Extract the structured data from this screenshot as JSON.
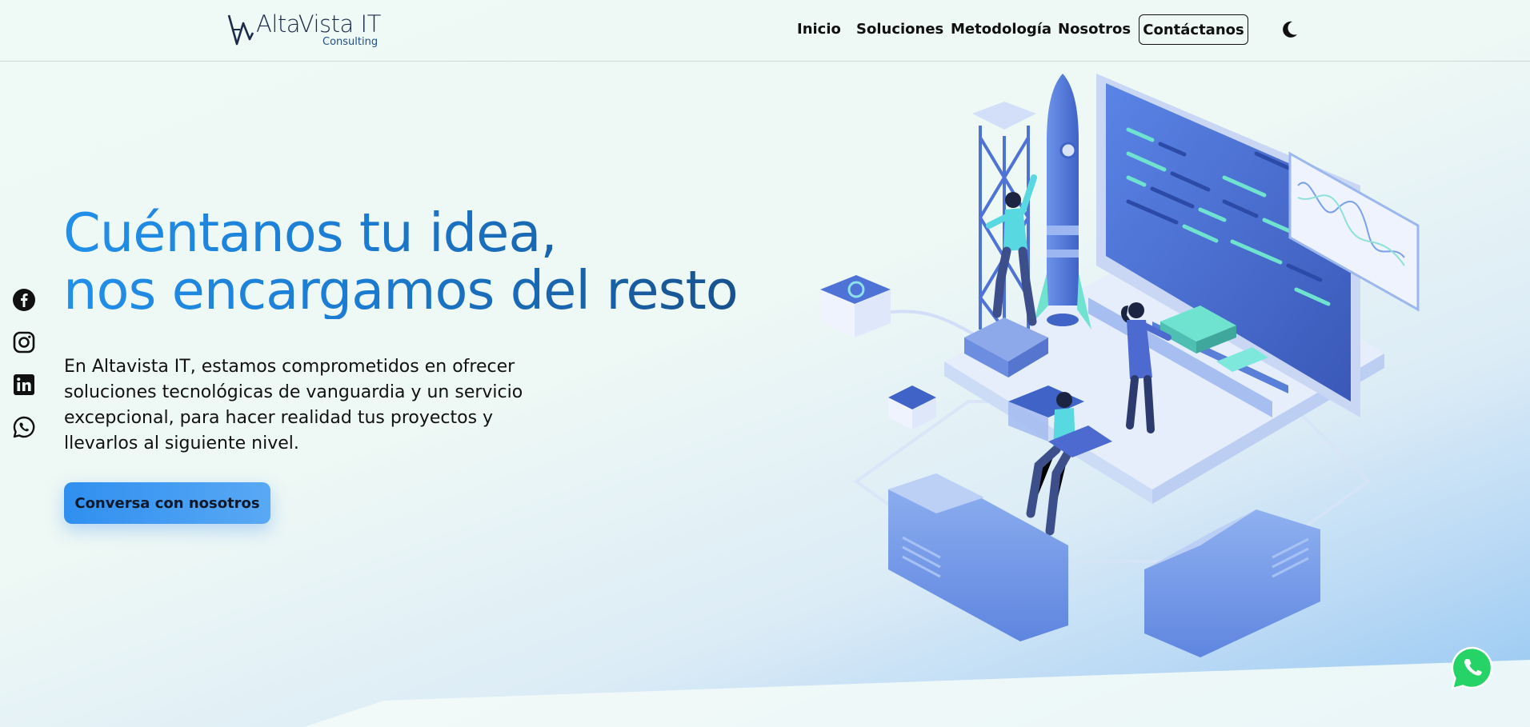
{
  "header": {
    "logo": {
      "name": "AltaVista IT",
      "tagline": "Consulting"
    },
    "nav": [
      {
        "label": "Inicio"
      },
      {
        "label": "Soluciones"
      },
      {
        "label": "Metodología"
      },
      {
        "label": "Nosotros"
      }
    ],
    "contact_label": "Contáctanos",
    "theme_icon": "moon-icon"
  },
  "social": [
    {
      "icon": "facebook-icon"
    },
    {
      "icon": "instagram-icon"
    },
    {
      "icon": "linkedin-icon"
    },
    {
      "icon": "whatsapp-icon"
    }
  ],
  "hero": {
    "title_line1": "Cuéntanos tu idea,",
    "title_line2": "nos encargamos del resto",
    "description": "En Altavista IT, estamos comprometidos en ofrecer soluciones tecnológicas de vanguardia y un servicio excepcional, para hacer realidad tus proyectos y llevarlos al siguiente nivel.",
    "cta_label": "Conversa con nosotros"
  },
  "colors": {
    "accent": "#2190ea",
    "accent_dark": "#17518d",
    "cta": "#3a95f0",
    "whatsapp": "#25d366"
  },
  "floating": {
    "icon": "whatsapp-floating-icon"
  }
}
